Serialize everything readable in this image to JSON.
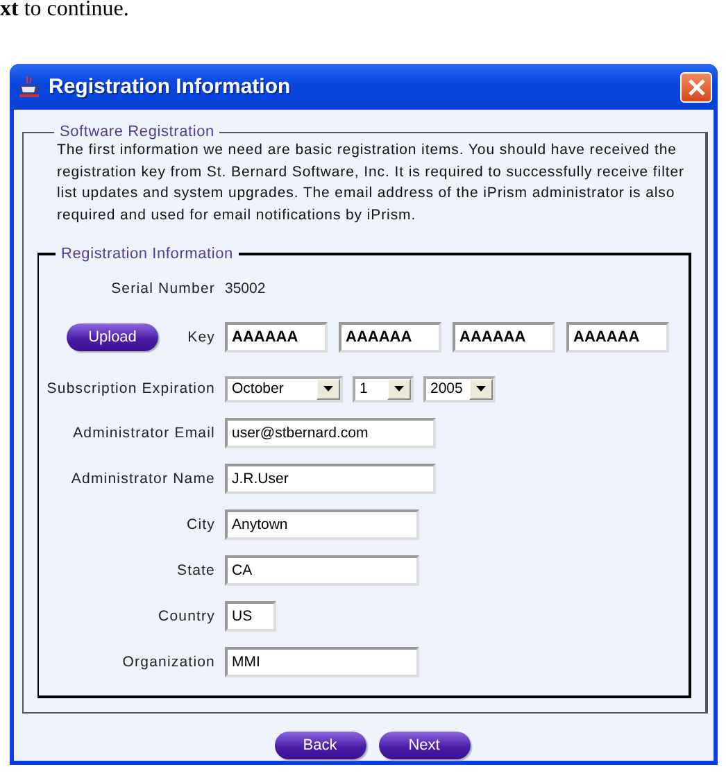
{
  "doc_text": "**xt** to continue.",
  "window": {
    "title": "Registration Information"
  },
  "software_registration": {
    "legend": "Software Registration",
    "text": "The first information we need are basic registration items.  You should have received the registration key from St. Bernard Software, Inc.  It is required to successfully receive filter list updates and system upgrades. The email address of the iPrism administrator is also required and used for email notifications by iPrism."
  },
  "registration_information": {
    "legend": "Registration Information",
    "serial": {
      "label": "Serial Number",
      "value": "35002"
    },
    "upload_button": "Upload",
    "key": {
      "label": "Key",
      "values": [
        "AAAAAA",
        "AAAAAA",
        "AAAAAA",
        "AAAAAA"
      ]
    },
    "expiration": {
      "label": "Subscription Expiration",
      "month": "October",
      "day": "1",
      "year": "2005"
    },
    "fields": [
      {
        "label": "Administrator Email",
        "value": "user@stbernard.com",
        "kind": "long"
      },
      {
        "label": "Administrator Name",
        "value": "J.R.User",
        "kind": "long"
      },
      {
        "label": "City",
        "value": "Anytown",
        "kind": "medium"
      },
      {
        "label": "State",
        "value": "CA",
        "kind": "medium"
      },
      {
        "label": "Country",
        "value": "US",
        "kind": "short"
      },
      {
        "label": "Organization",
        "value": "MMI",
        "kind": "medium"
      }
    ]
  },
  "buttons": [
    "Back",
    "Next"
  ]
}
